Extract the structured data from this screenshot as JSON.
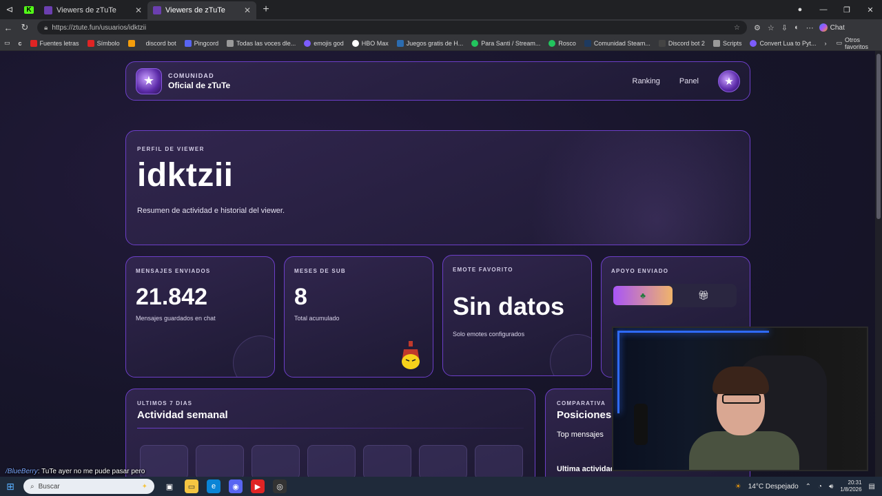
{
  "browser": {
    "tabs": [
      {
        "label": "Viewers de zTuTe",
        "active": false
      },
      {
        "label": "Viewers de zTuTe",
        "active": true
      }
    ],
    "url": "https://ztute.fun/usuarios/idktzii",
    "chat_label": "Chat",
    "bookmarks": [
      {
        "label": "Fuentes letras",
        "color": "#e02424"
      },
      {
        "label": "Símbolo",
        "color": "#e02424"
      },
      {
        "label": "",
        "color": "#f59e0b"
      },
      {
        "label": "discord bot",
        "color": "#444444"
      },
      {
        "label": "Pingcord",
        "color": "#5865f2"
      },
      {
        "label": "Todas las voces dle...",
        "color": "#999999"
      },
      {
        "label": "emojis god",
        "color": "#7c5cff"
      },
      {
        "label": "HBO Max",
        "color": "#ffffff"
      },
      {
        "label": "Juegos gratis de H...",
        "color": "#2b6cb0"
      },
      {
        "label": "Para Santi / Stream...",
        "color": "#22c55e"
      },
      {
        "label": "Rosco",
        "color": "#22c55e"
      },
      {
        "label": "Comunidad Steam...",
        "color": "#1e3a5f"
      },
      {
        "label": "Discord bot 2",
        "color": "#444444"
      },
      {
        "label": "Scripts",
        "color": "#999999"
      },
      {
        "label": "Convert Lua to Pyt...",
        "color": "#7c5cff"
      }
    ],
    "other_bookmarks": "Otros favoritos"
  },
  "header": {
    "kicker": "COMUNIDAD",
    "name": "Oficial de zTuTe",
    "nav": [
      "Ranking",
      "Panel"
    ]
  },
  "hero": {
    "kicker": "PERFIL DE VIEWER",
    "username": "idktzii",
    "subtitle": "Resumen de actividad e historial del viewer."
  },
  "stats": [
    {
      "kicker": "MENSAJES ENVIADOS",
      "value": "21.842",
      "desc": "Mensajes guardados en chat"
    },
    {
      "kicker": "MESES DE SUB",
      "value": "8",
      "desc": "Total acumulado"
    },
    {
      "kicker": "EMOTE FAVORITO",
      "value": "Sin datos",
      "desc": "Solo emotes configurados"
    },
    {
      "kicker": "APOYO ENVIADO",
      "value": "",
      "desc": ""
    }
  ],
  "activity": {
    "kicker": "ULTIMOS 7 DIAS",
    "title": "Actividad semanal"
  },
  "compare": {
    "kicker": "COMPARATIVA",
    "title": "Posiciones",
    "row1": "Top mensajes",
    "row2": "Ultima actividad"
  },
  "chat_overlay": {
    "user": "/BlueBerry",
    "message": ": TuTe ayer no me pude pasar pero"
  },
  "taskbar": {
    "search_placeholder": "Buscar",
    "weather": "14°C  Despejado",
    "time": "20:31",
    "date": "1/8/2026"
  }
}
